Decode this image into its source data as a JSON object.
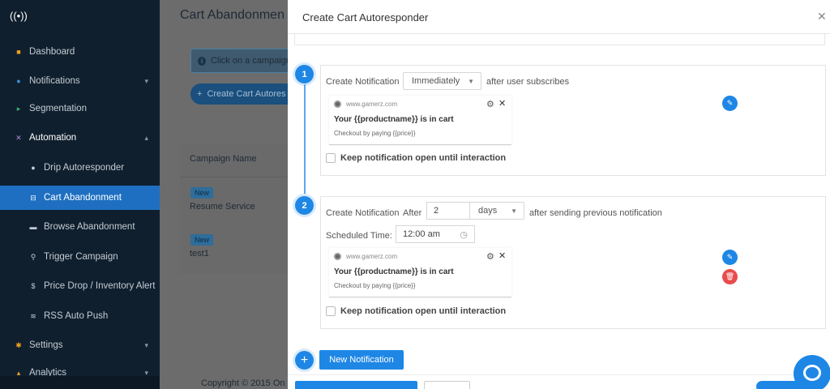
{
  "sidebar": {
    "items": [
      {
        "label": "Dashboard",
        "icon": "dashboard-icon",
        "glyph": "■"
      },
      {
        "label": "Notifications",
        "icon": "bell-icon",
        "glyph": "●"
      },
      {
        "label": "Segmentation",
        "icon": "segmentation-icon",
        "glyph": "▸"
      },
      {
        "label": "Automation",
        "icon": "automation-icon",
        "glyph": "✕"
      },
      {
        "label": "Drip Autoresponder",
        "icon": "drop-icon",
        "glyph": "●"
      },
      {
        "label": "Cart Abandonment",
        "icon": "cart-icon",
        "glyph": "⊟"
      },
      {
        "label": "Browse Abandonment",
        "icon": "browser-icon",
        "glyph": "▬"
      },
      {
        "label": "Trigger Campaign",
        "icon": "trigger-icon",
        "glyph": "⚲"
      },
      {
        "label": "Price Drop / Inventory Alert",
        "icon": "dollar-icon",
        "glyph": "$"
      },
      {
        "label": "RSS Auto Push",
        "icon": "rss-icon",
        "glyph": "≋"
      },
      {
        "label": "Settings",
        "icon": "settings-icon",
        "glyph": "✱"
      },
      {
        "label": "Analytics",
        "icon": "analytics-icon",
        "glyph": "▴"
      }
    ]
  },
  "background_page": {
    "title": "Cart Abandonmen",
    "info": "Click on a campaign",
    "create_button": "Create Cart Autores",
    "table_header": "Campaign Name",
    "rows": [
      {
        "badge": "New",
        "name": "Resume Service"
      },
      {
        "badge": "New",
        "name": "test1"
      }
    ],
    "footer": "Copyright © 2015 On"
  },
  "modal": {
    "title": "Create Cart Autoresponder",
    "steps": [
      {
        "number": "1",
        "create_label": "Create Notification",
        "timing": "Immediately",
        "after_text": "after user subscribes",
        "notification": {
          "site": "www.gamerz.com",
          "title": "Your {{productname}} is in cart",
          "body": "Checkout by paying {{price}}"
        },
        "keep_open_label": "Keep notification open until interaction"
      },
      {
        "number": "2",
        "create_label": "Create Notification",
        "after_word": "After",
        "delay_value": "2",
        "delay_unit": "days",
        "after_text": "after sending previous notification",
        "scheduled_label": "Scheduled Time:",
        "scheduled_time": "12:00 am",
        "notification": {
          "site": "www.gamerz.com",
          "title": "Your {{productname}} is in cart",
          "body": "Checkout by paying {{price}}"
        },
        "keep_open_label": "Keep notification open until interaction"
      }
    ],
    "add_symbol": "+",
    "new_notification_button": "New Notification"
  },
  "colors": {
    "accent": "#1e87e5",
    "sidebar_bg": "#0f1f2e",
    "active_nav": "#1e6fc1",
    "delete": "#e84c4c"
  }
}
